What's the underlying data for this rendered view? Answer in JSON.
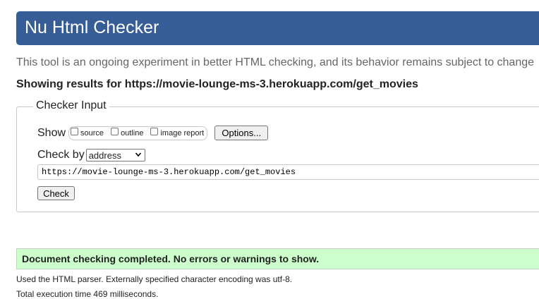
{
  "header": {
    "title": "Nu Html Checker"
  },
  "intro_text": "This tool is an ongoing experiment in better HTML checking, and its behavior remains subject to change",
  "showing_results": "Showing results for https://movie-lounge-ms-3.herokuapp.com/get_movies",
  "checker_input": {
    "legend": "Checker Input",
    "show_label": "Show",
    "show_options": [
      {
        "label": "source",
        "checked": false
      },
      {
        "label": "outline",
        "checked": false
      },
      {
        "label": "image report",
        "checked": false
      }
    ],
    "options_button": "Options...",
    "check_by_label": "Check by",
    "check_by_selected": "address",
    "url_value": "https://movie-lounge-ms-3.herokuapp.com/get_movies",
    "check_button": "Check"
  },
  "result": {
    "message": "Document checking completed. No errors or warnings to show.",
    "color": "#ccffcc"
  },
  "info": {
    "parser": "Used the HTML parser. Externally specified character encoding was utf-8.",
    "time": "Total execution time 469 milliseconds."
  },
  "colors": {
    "header_bg": "#365d95",
    "success_bg": "#ccffcc"
  }
}
